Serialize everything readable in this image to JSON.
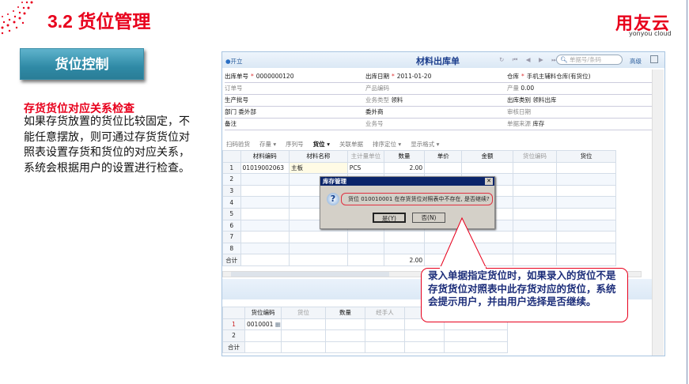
{
  "slide": {
    "title": "3.2 货位管理",
    "section_button": "货位控制",
    "heading": "存货货位对应关系检查",
    "body": "如果存货放置的货位比较固定，不能任意摆放，则可通过存货货位对照表设置存货和货位的对应关系，系统会根据用户的设置进行检查。",
    "logo": "用友云",
    "logo_sub": "yonyou cloud",
    "callout": "录入单据指定货位时，如果录入的货位不是存货货位对照表中此存货对应的货位，系统会提示用户，并由用户选择是否继续。"
  },
  "app": {
    "open_label": "开立",
    "form_title": "材料出库单",
    "search_placeholder": "单据号/条码",
    "advanced": "高级",
    "fields": [
      {
        "label": "出库单号",
        "value": "0000000120",
        "required": true
      },
      {
        "label": "出库日期",
        "value": "2011-01-20",
        "required": true
      },
      {
        "label": "仓库",
        "value": "手机主辅料仓库(有货位)",
        "required": true
      },
      {
        "label": "订单号",
        "value": ""
      },
      {
        "label": "产品编码",
        "value": ""
      },
      {
        "label": "产量",
        "value": "0.00"
      },
      {
        "label": "生产批号",
        "value": ""
      },
      {
        "label": "业务类型",
        "value": "领料"
      },
      {
        "label": "出库类别",
        "value": "领料出库"
      },
      {
        "label": "部门",
        "value": "委外部"
      },
      {
        "label": "委外商",
        "value": ""
      },
      {
        "label": "审核日期",
        "value": ""
      },
      {
        "label": "备注",
        "value": ""
      },
      {
        "label": "业务号",
        "value": ""
      },
      {
        "label": "单据来源",
        "value": "库存"
      }
    ],
    "grid_toolbar": [
      "扫码验货",
      "存量 ▾",
      "序列号",
      "货位 ▾",
      "关联单据",
      "排序定位 ▾",
      "显示格式 ▾"
    ],
    "grid_columns": [
      "材料编码",
      "材料名称",
      "主计量单位",
      "数量",
      "单价",
      "金额",
      "货位编码",
      "货位"
    ],
    "grid_rows": [
      {
        "n": "1",
        "code": "01019002063",
        "name": "主板",
        "unit": "PCS",
        "qty": "2.00"
      },
      {
        "n": "2"
      },
      {
        "n": "3"
      },
      {
        "n": "4"
      },
      {
        "n": "5"
      },
      {
        "n": "6"
      },
      {
        "n": "7"
      },
      {
        "n": "8"
      }
    ],
    "total_label": "合计",
    "total_qty": "2.00",
    "sub_columns": [
      "货位编码",
      "货位",
      "数量",
      "经手人"
    ],
    "sub_rows": [
      {
        "n": "1",
        "code": "0010001"
      },
      {
        "n": "2"
      }
    ],
    "sub_total": "合计"
  },
  "dialog": {
    "title": "库存管理",
    "message": "货位 010010001 在存货货位对照表中不存在, 是否继续?",
    "yes": "是(Y)",
    "no": "否(N)"
  }
}
